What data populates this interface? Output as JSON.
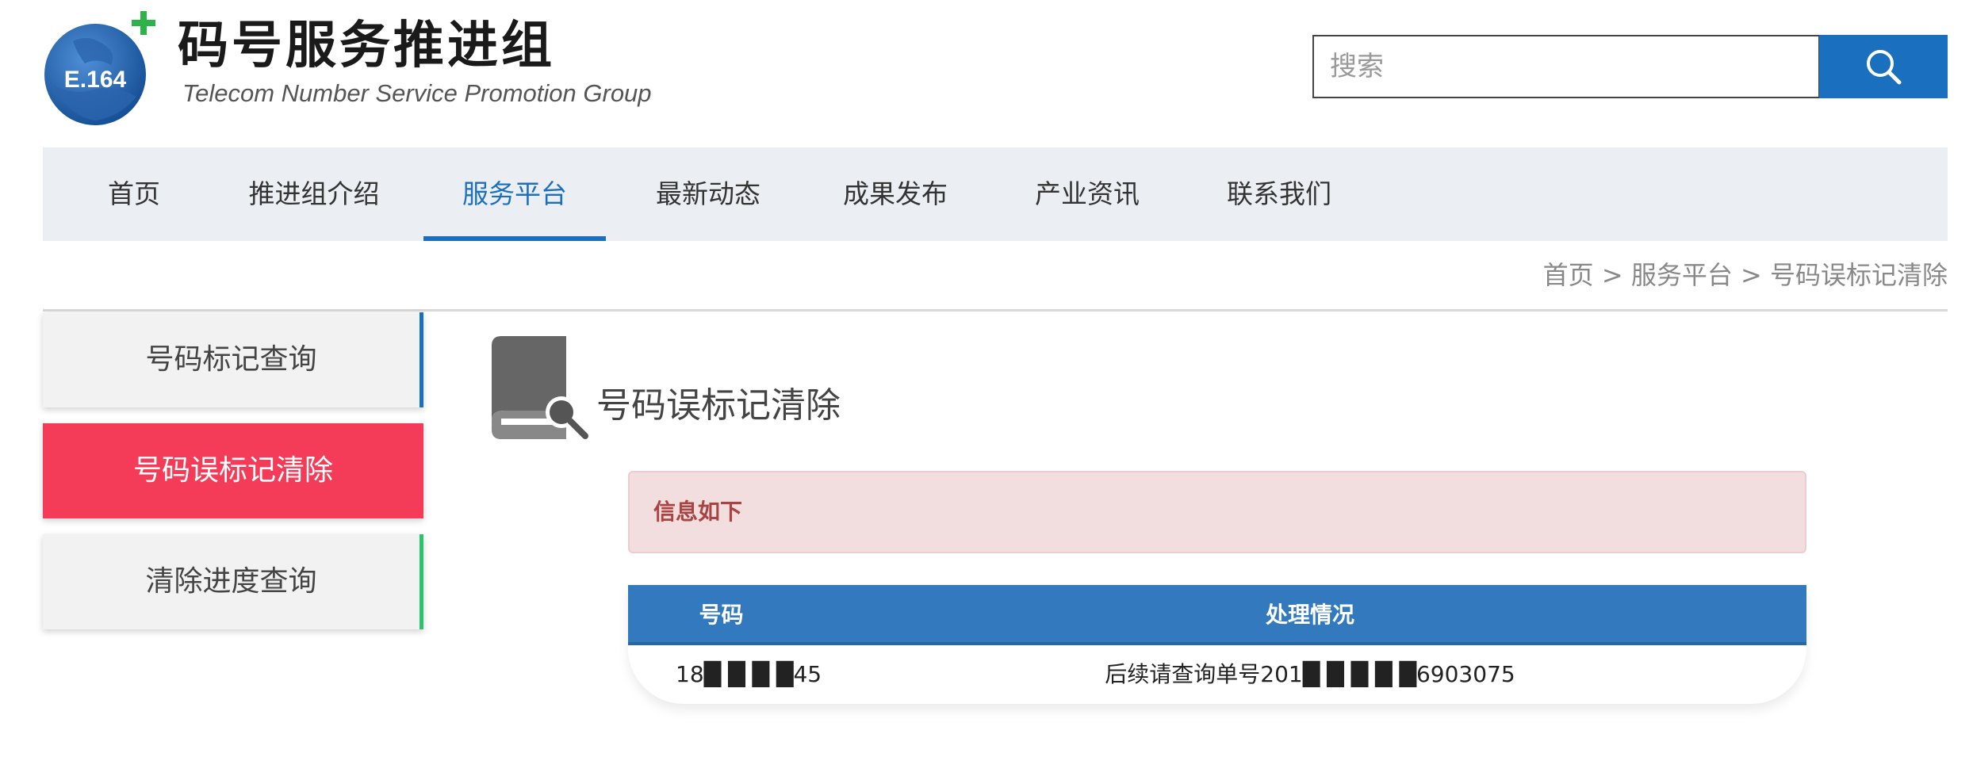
{
  "header": {
    "logo_text": "E.164",
    "brand_cn": "码号服务推进组",
    "brand_en": "Telecom Number Service  Promotion Group",
    "search": {
      "placeholder": "搜索"
    }
  },
  "nav": {
    "items": [
      "首页",
      "推进组介绍",
      "服务平台",
      "最新动态",
      "成果发布",
      "产业资讯",
      "联系我们"
    ],
    "active_index": 2
  },
  "breadcrumb": "首页 > 服务平台 > 号码误标记清除",
  "sidebar": {
    "items": [
      "号码标记查询",
      "号码误标记清除",
      "清除进度查询"
    ],
    "active_index": 1
  },
  "main": {
    "title": "号码误标记清除",
    "alert": "信息如下",
    "table": {
      "headers": [
        "号码",
        "处理情况"
      ],
      "rows": [
        {
          "number": "18█ █ █ █45",
          "status": "后续请查询单号201█ █ █ █ █6903075"
        }
      ]
    }
  },
  "colors": {
    "brand_blue": "#1a6fbe",
    "nav_bg": "#ebeff3",
    "active_sidebar": "#f43c58",
    "table_header": "#327abd",
    "alert_bg": "#f2dede",
    "alert_text": "#a94442"
  }
}
